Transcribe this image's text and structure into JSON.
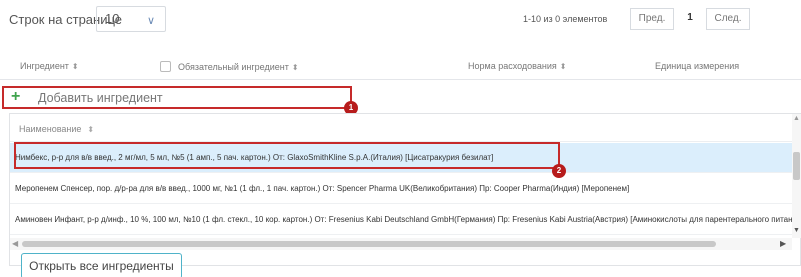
{
  "pager": {
    "rows_per_page_label": "Строк на странице",
    "rows_per_page_value": "10",
    "info": "1-10 из 0 элементов",
    "prev_label": "Пред.",
    "current_page": "1",
    "next_label": "След."
  },
  "table": {
    "columns": [
      {
        "label": "Ингредиент",
        "sortable": true
      },
      {
        "label": "Обязательный ингредиент",
        "sortable": true,
        "checkbox": true
      },
      {
        "label": "Норма расходования",
        "sortable": true
      },
      {
        "label": "Единица измерения",
        "sortable": false
      }
    ]
  },
  "add_ingredient": {
    "plus": "+",
    "label": "Добавить ингредиент"
  },
  "annotations": {
    "badge1": "1",
    "badge2": "2",
    "highlight_color": "#c62a2a"
  },
  "dropdown": {
    "column_header": "Наименование",
    "rows": [
      "Нимбекс, р-р для в/в введ., 2 мг/мл, 5 мл, №5 (1 амп., 5 пач. картон.) От: GlaxoSmithKline S.p.A.(Италия) [Цисатракурия безилат]",
      "Меропенем Спенсер, пор. д/р-ра для в/в введ., 1000 мг, №1 (1 фл., 1 пач. картон.) От: Spencer Pharma UK(Великобритания) Пр: Cooper Pharma(Индия) [Меропенем]",
      "Аминовен Инфант, р-р д/инф., 10 %, 100 мл, №10 (1 фл. стекл., 10 кор. картон.) От: Fresenius Kabi Deutschland GmbH(Германия) Пр: Fresenius Kabi Austria(Австрия) [Аминокислоты для парентерального питания]"
    ],
    "selected_index": 0,
    "selected_color": "#dbeefc"
  },
  "open_all_button": "Открыть все ингредиенты"
}
